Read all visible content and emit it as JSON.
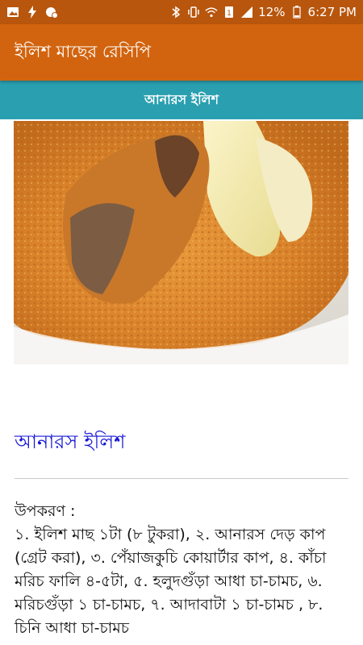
{
  "status_bar": {
    "battery": "12%",
    "time": "6:27 PM",
    "icons": [
      "image-icon",
      "flash-icon",
      "data-saver-icon",
      "bluetooth-icon",
      "vibrate-icon",
      "wifi-icon",
      "sim-icon",
      "signal-icon",
      "battery-icon"
    ]
  },
  "app_bar": {
    "title": "ইলিশ মাছের রেসিপি"
  },
  "sub_bar": {
    "title": "আনারস ইলিশ"
  },
  "recipe": {
    "title": "আনারস ইলিশ",
    "ingredients_heading": "উপকরণ :",
    "ingredients_text": "১. ইলিশ মাছ ১টা (৮ টুকরা), ২. আনারস দেড় কাপ (গ্রেট করা), ৩. পেঁয়াজকুচি কোয়ার্টার কাপ, ৪. কাঁচা মরিচ ফালি ৪-৫টা, ৫. হলুদগুঁড়া আধা চা-চামচ, ৬. মরিচগুঁড়া ১ চা-চামচ, ৭. আদাবাটা ১ চা-চামচ , ৮. চিনি আধা চা-চামচ"
  }
}
